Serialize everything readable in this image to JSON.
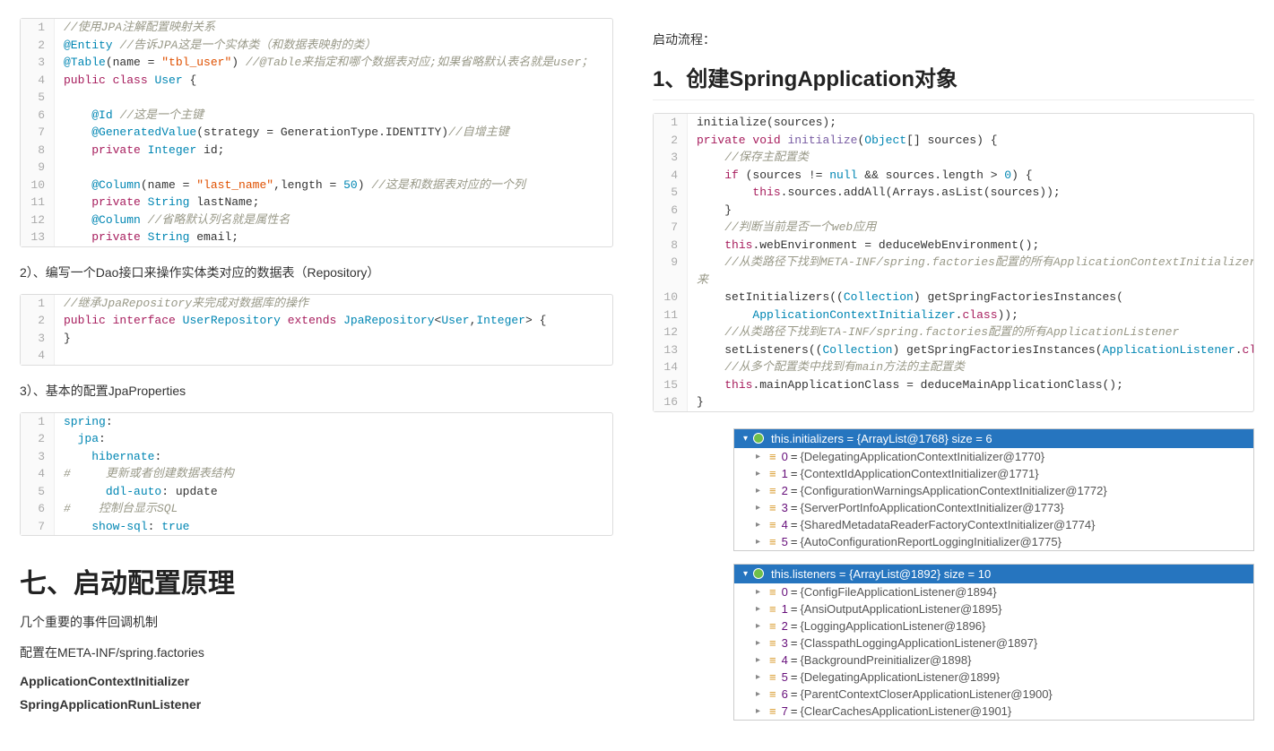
{
  "left": {
    "code1": [
      [
        {
          "t": "//使用JPA注解配置映射关系",
          "c": "k-comment"
        }
      ],
      [
        {
          "t": "@Entity",
          "c": "k-anno"
        },
        {
          "t": " "
        },
        {
          "t": "//告诉JPA这是一个实体类（和数据表映射的类）",
          "c": "k-comment"
        }
      ],
      [
        {
          "t": "@Table",
          "c": "k-anno"
        },
        {
          "t": "(name = "
        },
        {
          "t": "\"tbl_user\"",
          "c": "k-string"
        },
        {
          "t": ") "
        },
        {
          "t": "//@Table来指定和哪个数据表对应;如果省略默认表名就是user；",
          "c": "k-comment"
        }
      ],
      [
        {
          "t": "public",
          "c": "k-keyword"
        },
        {
          "t": " "
        },
        {
          "t": "class",
          "c": "k-keyword"
        },
        {
          "t": " "
        },
        {
          "t": "User",
          "c": "k-type"
        },
        {
          "t": " {"
        }
      ],
      [
        {
          "t": ""
        }
      ],
      [
        {
          "t": "    "
        },
        {
          "t": "@Id",
          "c": "k-anno"
        },
        {
          "t": " "
        },
        {
          "t": "//这是一个主键",
          "c": "k-comment"
        }
      ],
      [
        {
          "t": "    "
        },
        {
          "t": "@GeneratedValue",
          "c": "k-anno"
        },
        {
          "t": "(strategy = GenerationType.IDENTITY)"
        },
        {
          "t": "//自增主键",
          "c": "k-comment"
        }
      ],
      [
        {
          "t": "    "
        },
        {
          "t": "private",
          "c": "k-keyword"
        },
        {
          "t": " "
        },
        {
          "t": "Integer",
          "c": "k-type"
        },
        {
          "t": " id;"
        }
      ],
      [
        {
          "t": ""
        }
      ],
      [
        {
          "t": "    "
        },
        {
          "t": "@Column",
          "c": "k-anno"
        },
        {
          "t": "(name = "
        },
        {
          "t": "\"last_name\"",
          "c": "k-string"
        },
        {
          "t": ",length = "
        },
        {
          "t": "50",
          "c": "k-lit"
        },
        {
          "t": ") "
        },
        {
          "t": "//这是和数据表对应的一个列",
          "c": "k-comment"
        }
      ],
      [
        {
          "t": "    "
        },
        {
          "t": "private",
          "c": "k-keyword"
        },
        {
          "t": " "
        },
        {
          "t": "String",
          "c": "k-type"
        },
        {
          "t": " lastName;"
        }
      ],
      [
        {
          "t": "    "
        },
        {
          "t": "@Column",
          "c": "k-anno"
        },
        {
          "t": " "
        },
        {
          "t": "//省略默认列名就是属性名",
          "c": "k-comment"
        }
      ],
      [
        {
          "t": "    "
        },
        {
          "t": "private",
          "c": "k-keyword"
        },
        {
          "t": " "
        },
        {
          "t": "String",
          "c": "k-type"
        },
        {
          "t": " email;"
        }
      ]
    ],
    "p1": "2）、编写一个Dao接口来操作实体类对应的数据表（Repository）",
    "code2": [
      [
        {
          "t": "//继承JpaRepository来完成对数据库的操作",
          "c": "k-comment"
        }
      ],
      [
        {
          "t": "public",
          "c": "k-keyword"
        },
        {
          "t": " "
        },
        {
          "t": "interface",
          "c": "k-keyword"
        },
        {
          "t": " "
        },
        {
          "t": "UserRepository",
          "c": "k-type"
        },
        {
          "t": " "
        },
        {
          "t": "extends",
          "c": "k-keyword"
        },
        {
          "t": " "
        },
        {
          "t": "JpaRepository",
          "c": "k-type"
        },
        {
          "t": "<"
        },
        {
          "t": "User",
          "c": "k-type"
        },
        {
          "t": ","
        },
        {
          "t": "Integer",
          "c": "k-type"
        },
        {
          "t": "> {"
        }
      ],
      [
        {
          "t": "}"
        }
      ],
      [
        {
          "t": ""
        }
      ]
    ],
    "p2": "3）、基本的配置JpaProperties",
    "code3": [
      [
        {
          "t": "spring",
          "c": "k-type"
        },
        {
          "t": ":"
        }
      ],
      [
        {
          "t": "  "
        },
        {
          "t": "jpa",
          "c": "k-type"
        },
        {
          "t": ":"
        }
      ],
      [
        {
          "t": "    "
        },
        {
          "t": "hibernate",
          "c": "k-type"
        },
        {
          "t": ":"
        }
      ],
      [
        {
          "t": "#     更新或者创建数据表结构",
          "c": "k-comment"
        }
      ],
      [
        {
          "t": "      "
        },
        {
          "t": "ddl-auto",
          "c": "k-type"
        },
        {
          "t": ": update"
        }
      ],
      [
        {
          "t": "#    控制台显示SQL",
          "c": "k-comment"
        }
      ],
      [
        {
          "t": "    "
        },
        {
          "t": "show-sql",
          "c": "k-type"
        },
        {
          "t": ": "
        },
        {
          "t": "true",
          "c": "k-lit"
        }
      ]
    ],
    "h1": "七、启动配置原理",
    "p3": "几个重要的事件回调机制",
    "p4": "配置在META-INF/spring.factories",
    "p5": "ApplicationContextInitializer",
    "p6": "SpringApplicationRunListener"
  },
  "right": {
    "p0": "启动流程：",
    "h2": "1、创建SpringApplication对象",
    "code4": [
      [
        {
          "t": "initialize(sources);"
        }
      ],
      [
        {
          "t": "private",
          "c": "k-keyword"
        },
        {
          "t": " "
        },
        {
          "t": "void",
          "c": "k-keyword"
        },
        {
          "t": " "
        },
        {
          "t": "initialize",
          "c": "k-func"
        },
        {
          "t": "("
        },
        {
          "t": "Object",
          "c": "k-type"
        },
        {
          "t": "[] sources) {"
        }
      ],
      [
        {
          "t": "    "
        },
        {
          "t": "//保存主配置类",
          "c": "k-comment"
        }
      ],
      [
        {
          "t": "    "
        },
        {
          "t": "if",
          "c": "k-keyword"
        },
        {
          "t": " (sources != "
        },
        {
          "t": "null",
          "c": "k-lit"
        },
        {
          "t": " && sources.length > "
        },
        {
          "t": "0",
          "c": "k-lit"
        },
        {
          "t": ") {"
        }
      ],
      [
        {
          "t": "        "
        },
        {
          "t": "this",
          "c": "k-keyword"
        },
        {
          "t": ".sources.addAll(Arrays.asList(sources));"
        }
      ],
      [
        {
          "t": "    }"
        }
      ],
      [
        {
          "t": "    "
        },
        {
          "t": "//判断当前是否一个web应用",
          "c": "k-comment"
        }
      ],
      [
        {
          "t": "    "
        },
        {
          "t": "this",
          "c": "k-keyword"
        },
        {
          "t": ".webEnvironment = deduceWebEnvironment();"
        }
      ],
      [
        {
          "t": "    "
        },
        {
          "t": "//从类路径下找到META-INF/spring.factories配置的所有ApplicationContextInitializer；然后保",
          "c": "k-comment"
        }
      ],
      [
        {
          "t": "    setInitializers(("
        },
        {
          "t": "Collection",
          "c": "k-type"
        },
        {
          "t": ") getSpringFactoriesInstances("
        }
      ],
      [
        {
          "t": "        "
        },
        {
          "t": "ApplicationContextInitializer",
          "c": "k-type"
        },
        {
          "t": "."
        },
        {
          "t": "class",
          "c": "k-keyword"
        },
        {
          "t": "));"
        }
      ],
      [
        {
          "t": "    "
        },
        {
          "t": "//从类路径下找到ETA-INF/spring.factories配置的所有ApplicationListener",
          "c": "k-comment"
        }
      ],
      [
        {
          "t": "    setListeners(("
        },
        {
          "t": "Collection",
          "c": "k-type"
        },
        {
          "t": ") getSpringFactoriesInstances("
        },
        {
          "t": "ApplicationListener",
          "c": "k-type"
        },
        {
          "t": "."
        },
        {
          "t": "class",
          "c": "k-keyword"
        },
        {
          "t": "));"
        }
      ],
      [
        {
          "t": "    "
        },
        {
          "t": "//从多个配置类中找到有main方法的主配置类",
          "c": "k-comment"
        }
      ],
      [
        {
          "t": "    "
        },
        {
          "t": "this",
          "c": "k-keyword"
        },
        {
          "t": ".mainApplicationClass = deduceMainApplicationClass();"
        }
      ],
      [
        {
          "t": "}"
        }
      ]
    ],
    "code4extra": "来",
    "debug1": {
      "header": "this.initializers = {ArrayList@1768}  size = 6",
      "rows": [
        {
          "idx": "0",
          "val": "{DelegatingApplicationContextInitializer@1770}"
        },
        {
          "idx": "1",
          "val": "{ContextIdApplicationContextInitializer@1771}"
        },
        {
          "idx": "2",
          "val": "{ConfigurationWarningsApplicationContextInitializer@1772}"
        },
        {
          "idx": "3",
          "val": "{ServerPortInfoApplicationContextInitializer@1773}"
        },
        {
          "idx": "4",
          "val": "{SharedMetadataReaderFactoryContextInitializer@1774}"
        },
        {
          "idx": "5",
          "val": "{AutoConfigurationReportLoggingInitializer@1775}"
        }
      ]
    },
    "debug2": {
      "header": "this.listeners = {ArrayList@1892}  size = 10",
      "rows": [
        {
          "idx": "0",
          "val": "{ConfigFileApplicationListener@1894}"
        },
        {
          "idx": "1",
          "val": "{AnsiOutputApplicationListener@1895}"
        },
        {
          "idx": "2",
          "val": "{LoggingApplicationListener@1896}"
        },
        {
          "idx": "3",
          "val": "{ClasspathLoggingApplicationListener@1897}"
        },
        {
          "idx": "4",
          "val": "{BackgroundPreinitializer@1898}"
        },
        {
          "idx": "5",
          "val": "{DelegatingApplicationListener@1899}"
        },
        {
          "idx": "6",
          "val": "{ParentContextCloserApplicationListener@1900}"
        },
        {
          "idx": "7",
          "val": "{ClearCachesApplicationListener@1901}"
        }
      ]
    }
  }
}
